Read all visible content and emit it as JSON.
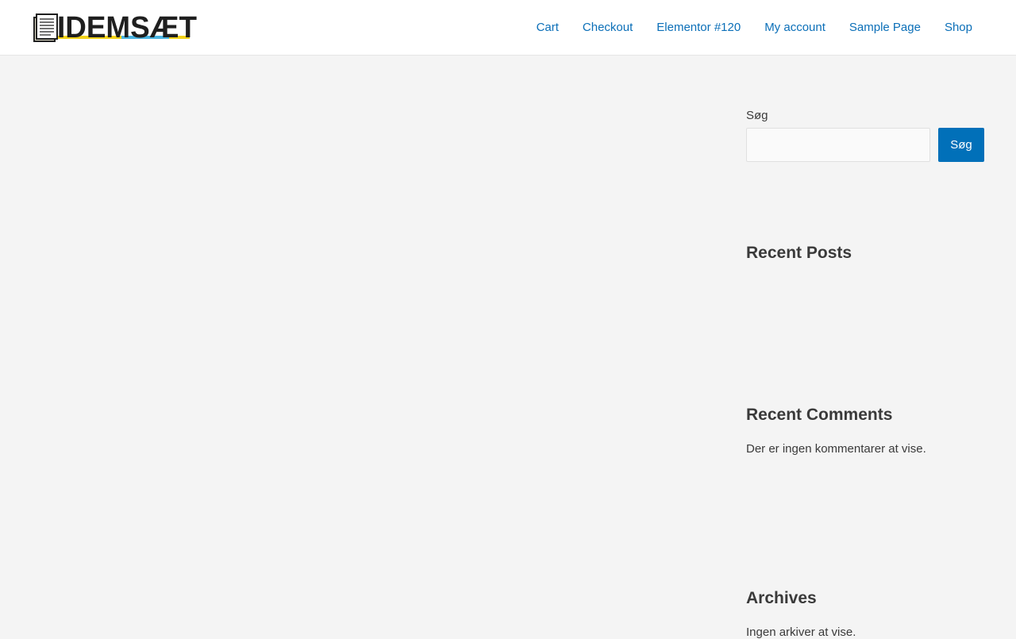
{
  "site": {
    "logo_text": "IDEMSÆT",
    "logo_icon": "notepad-icon",
    "colors": {
      "link": "#0b6fb8",
      "button": "#0170b9",
      "logo_dark": "#1f1f1f",
      "logo_accent_yellow": "#f2d21b",
      "logo_accent_cyan": "#4ab3e0",
      "background": "#f4f4f4"
    }
  },
  "nav": {
    "items": [
      "Cart",
      "Checkout",
      "Elementor #120",
      "My account",
      "Sample Page",
      "Shop"
    ]
  },
  "sidebar": {
    "search": {
      "label": "Søg",
      "placeholder": "",
      "value": "",
      "button_label": "Søg"
    },
    "recent_posts": {
      "title": "Recent Posts"
    },
    "recent_comments": {
      "title": "Recent Comments",
      "empty_text": "Der er ingen kommentarer at vise."
    },
    "archives": {
      "title": "Archives",
      "empty_text": "Ingen arkiver at vise."
    }
  }
}
